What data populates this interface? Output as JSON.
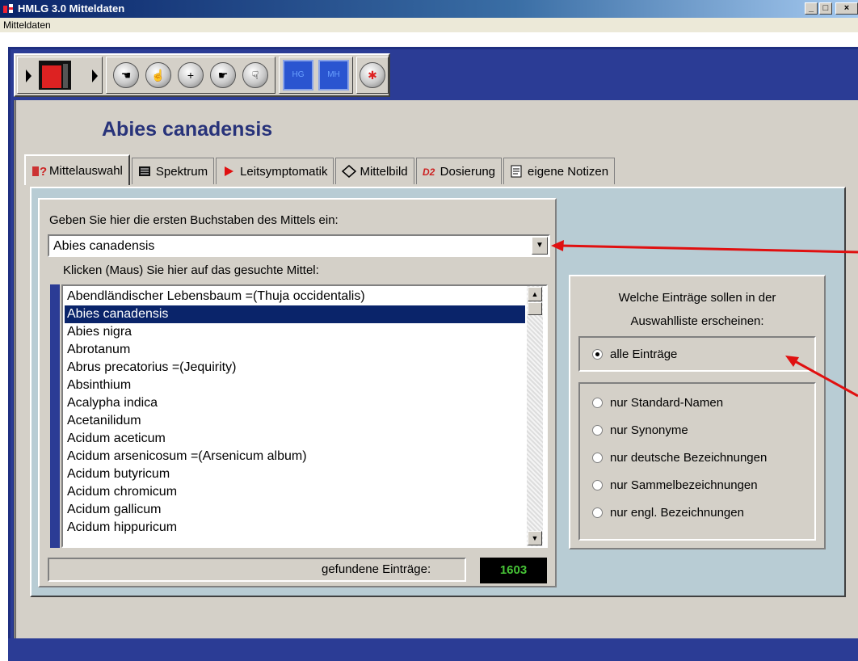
{
  "window": {
    "title": "HMLG 3.0 Mitteldaten",
    "btn_min": "_",
    "btn_max": "□",
    "btn_close": "×"
  },
  "menu": {
    "items": [
      "Mitteldaten"
    ]
  },
  "toolbar": {
    "buttons": [
      {
        "icon": "play-left-icon"
      },
      {
        "icon": "film-icon"
      },
      {
        "icon": "play-right-icon"
      },
      {
        "icon": "hand-left-icon"
      },
      {
        "icon": "hand-up-icon"
      },
      {
        "icon": "plus-icon"
      },
      {
        "icon": "hand-right-icon"
      },
      {
        "icon": "hand-down-icon"
      },
      {
        "icon": "hg-icon",
        "label": "HG"
      },
      {
        "icon": "mh-icon",
        "label": "MH"
      },
      {
        "icon": "exit-icon"
      }
    ]
  },
  "heading": "Abies canadensis",
  "tabs": [
    {
      "label": "Mittelauswahl",
      "icon": "question-icon",
      "active": true
    },
    {
      "label": "Spektrum",
      "icon": "spectrum-icon"
    },
    {
      "label": "Leitsymptomatik",
      "icon": "red-arrow-icon"
    },
    {
      "label": "Mittelbild",
      "icon": "diamond-icon"
    },
    {
      "label": "Dosierung",
      "icon": "dosage-icon"
    },
    {
      "label": "eigene Notizen",
      "icon": "notes-icon"
    }
  ],
  "search": {
    "prompt": "Geben Sie hier die ersten Buchstaben des Mittels ein:",
    "value": "Abies canadensis"
  },
  "list": {
    "prompt": "Klicken (Maus) Sie hier auf das gesuchte Mittel:",
    "items": [
      "Abendländischer Lebensbaum =(Thuja occidentalis)",
      "Abies canadensis",
      "Abies nigra",
      "Abrotanum",
      "Abrus precatorius =(Jequirity)",
      "Absinthium",
      "Acalypha indica",
      "Acetanilidum",
      "Acidum aceticum",
      "Acidum arsenicosum =(Arsenicum album)",
      "Acidum butyricum",
      "Acidum chromicum",
      "Acidum gallicum",
      "Acidum hippuricum"
    ],
    "selected_index": 1,
    "found_label": "gefundene Einträge:",
    "found_count": "1603"
  },
  "filter": {
    "title_line1": "Welche Einträge sollen in der",
    "title_line2": "Auswahlliste erscheinen:",
    "options": [
      {
        "label": "alle Einträge",
        "checked": true
      },
      {
        "label": "nur Standard-Namen",
        "checked": false
      },
      {
        "label": "nur Synonyme",
        "checked": false
      },
      {
        "label": "nur deutsche Bezeichnungen",
        "checked": false
      },
      {
        "label": "nur Sammelbezeichnungen",
        "checked": false
      },
      {
        "label": "nur engl. Bezeichnungen",
        "checked": false
      }
    ]
  },
  "colors": {
    "accent_red": "#e01010",
    "frame_blue": "#2b3c95",
    "count_green": "#46c236"
  }
}
